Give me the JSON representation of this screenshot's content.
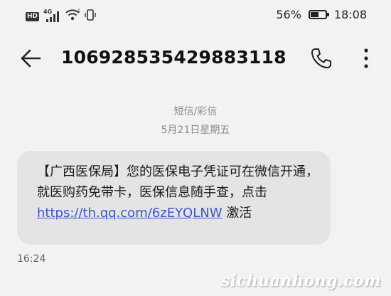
{
  "status_bar": {
    "hd_badge": "HD",
    "network": "4G",
    "battery_percent": "56%",
    "battery_level": 0.56,
    "time": "18:08",
    "icons": [
      "signal-icon",
      "wifi-icon",
      "vibrate-icon",
      "battery-icon"
    ]
  },
  "header": {
    "title": "1069285354298831­18",
    "back_icon": "back-arrow-icon",
    "call_icon": "phone-icon",
    "more_icon": "more-vertical-icon"
  },
  "thread": {
    "type_label": "短信/彩信",
    "date_label": "5月21日星期五"
  },
  "message": {
    "text_before_link": "【广西医保局】您的医保电子凭证可在微信开通，就医购药免带卡，医保信息随手查，点击 ",
    "link": "https://th.qq.com/6zEYQLNW",
    "text_after_link": " 激活",
    "time": "16:24"
  },
  "watermark": "sichuanhong.com",
  "colors": {
    "background": "#f2f2f2",
    "bubble": "#e4e4e4",
    "link": "#3b57c4",
    "muted_text": "#8a8a8a"
  }
}
